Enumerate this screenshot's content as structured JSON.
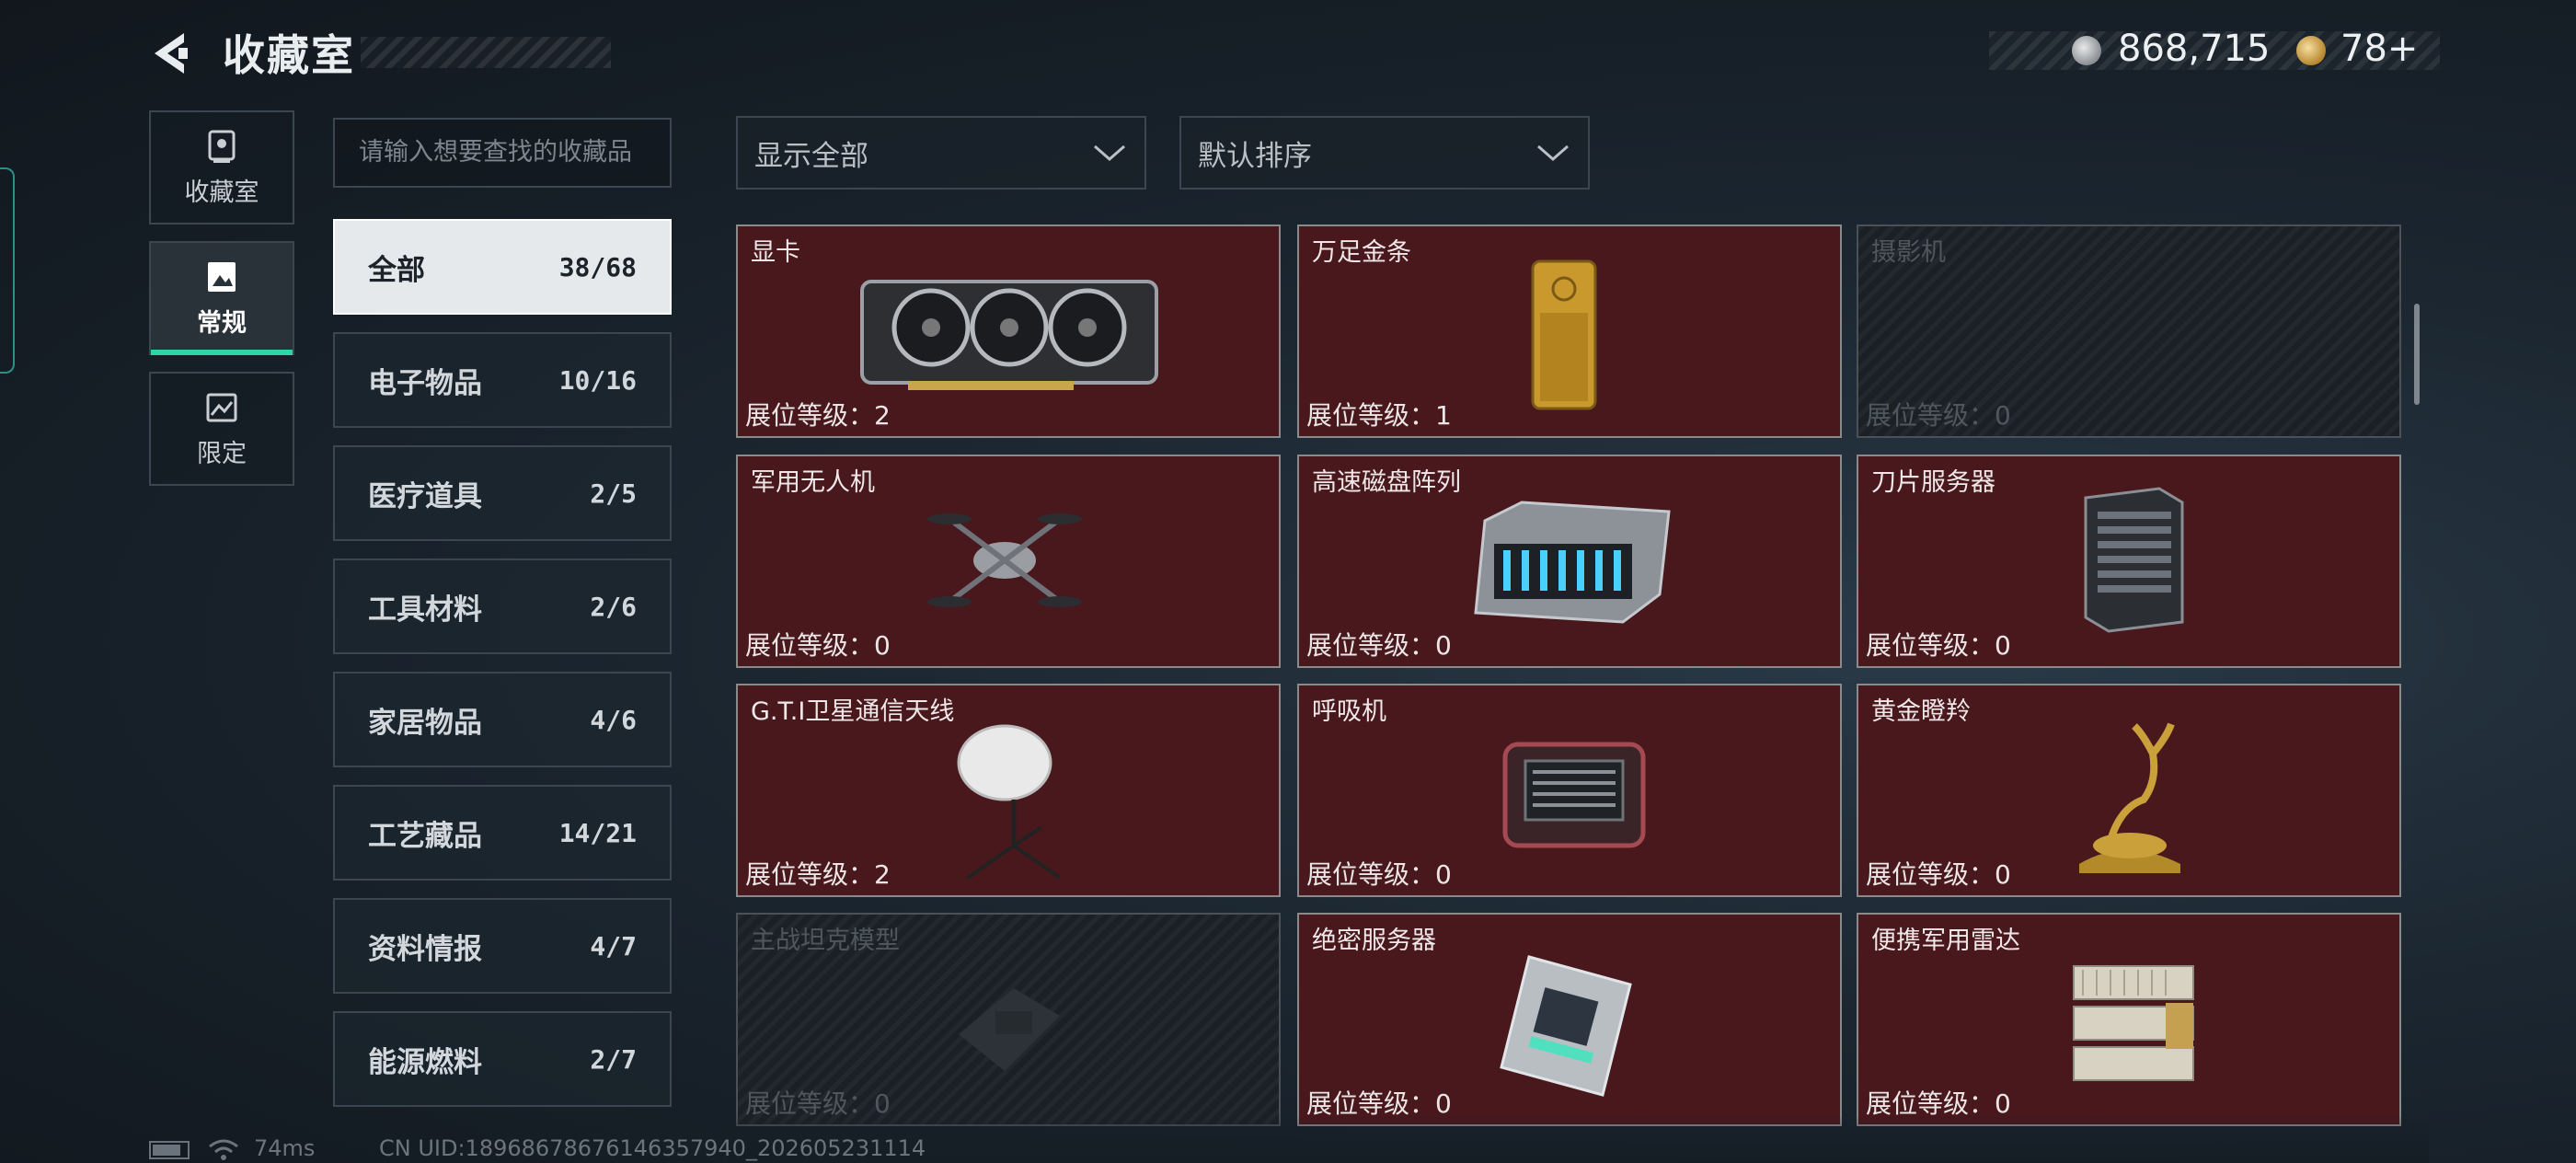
{
  "header": {
    "title": "收藏室"
  },
  "currency": {
    "silver": "868,715",
    "gold": "78+"
  },
  "side_tabs": [
    {
      "label": "收藏室",
      "icon": "trophy-case-icon",
      "active": false
    },
    {
      "label": "常规",
      "icon": "picture-icon",
      "active": true
    },
    {
      "label": "限定",
      "icon": "landscape-icon",
      "active": false
    }
  ],
  "search": {
    "placeholder": "请输入想要查找的收藏品"
  },
  "categories": [
    {
      "name": "全部",
      "count": "38/68",
      "active": true
    },
    {
      "name": "电子物品",
      "count": "10/16"
    },
    {
      "name": "医疗道具",
      "count": "2/5"
    },
    {
      "name": "工具材料",
      "count": "2/6"
    },
    {
      "name": "家居物品",
      "count": "4/6"
    },
    {
      "name": "工艺藏品",
      "count": "14/21"
    },
    {
      "name": "资料情报",
      "count": "4/7"
    },
    {
      "name": "能源燃料",
      "count": "2/7"
    }
  ],
  "filters": {
    "display": "显示全部",
    "sort": "默认排序"
  },
  "items": [
    {
      "name": "显卡",
      "level": "展位等级：2",
      "locked": false,
      "icon": "graphics-card-icon"
    },
    {
      "name": "万足金条",
      "level": "展位等级：1",
      "locked": false,
      "icon": "gold-bar-icon"
    },
    {
      "name": "摄影机",
      "level": "展位等级：0",
      "locked": true,
      "icon": "camera-icon"
    },
    {
      "name": "军用无人机",
      "level": "展位等级：0",
      "locked": false,
      "icon": "drone-icon"
    },
    {
      "name": "高速磁盘阵列",
      "level": "展位等级：0",
      "locked": false,
      "icon": "disk-array-icon"
    },
    {
      "name": "刀片服务器",
      "level": "展位等级：0",
      "locked": false,
      "icon": "blade-server-icon"
    },
    {
      "name": "G.T.I卫星通信天线",
      "level": "展位等级：2",
      "locked": false,
      "icon": "satellite-dish-icon"
    },
    {
      "name": "呼吸机",
      "level": "展位等级：0",
      "locked": false,
      "icon": "ventilator-icon"
    },
    {
      "name": "黄金瞪羚",
      "level": "展位等级：0",
      "locked": false,
      "icon": "gold-gazelle-icon"
    },
    {
      "name": "主战坦克模型",
      "level": "展位等级：0",
      "locked": true,
      "icon": "tank-model-icon"
    },
    {
      "name": "绝密服务器",
      "level": "展位等级：0",
      "locked": false,
      "icon": "server-icon"
    },
    {
      "name": "便携军用雷达",
      "level": "展位等级：0",
      "locked": false,
      "icon": "radar-icon"
    }
  ],
  "footer": {
    "ping": "74ms",
    "uid": "CN UID:18968678676146357940_202605231114"
  },
  "colors": {
    "accent": "#2fd5a8",
    "card_bg": "#48181d",
    "locked_bg": "#22282e"
  }
}
